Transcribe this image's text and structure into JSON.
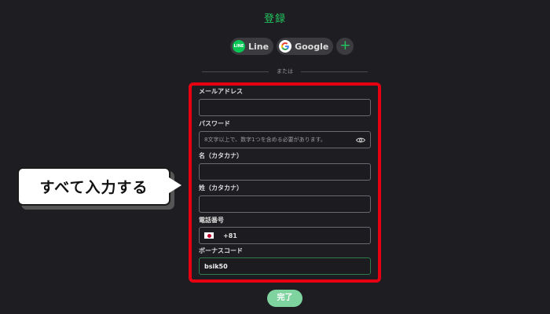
{
  "title": "登録",
  "social": {
    "line_label": "Line",
    "line_icon_text": "LINE",
    "google_label": "Google",
    "more_label": "+"
  },
  "divider_text": "または",
  "fields": {
    "email": {
      "label": "メールアドレス",
      "value": ""
    },
    "password": {
      "label": "パスワード",
      "placeholder": "8文字以上で、数字1つを含める必要があります。"
    },
    "first_name": {
      "label": "名（カタカナ）",
      "value": ""
    },
    "last_name": {
      "label": "姓（カタカナ）",
      "value": ""
    },
    "phone": {
      "label": "電話番号",
      "country_code": "+81"
    },
    "bonus_code": {
      "label": "ボーナスコード",
      "value": "bsik50"
    }
  },
  "callout_text": "すべて入力する",
  "submit_label": "完了",
  "colors": {
    "accent": "#22c55e",
    "highlight_border": "#e60012",
    "submit_bg": "#7ed39f",
    "line_green": "#06c755"
  }
}
